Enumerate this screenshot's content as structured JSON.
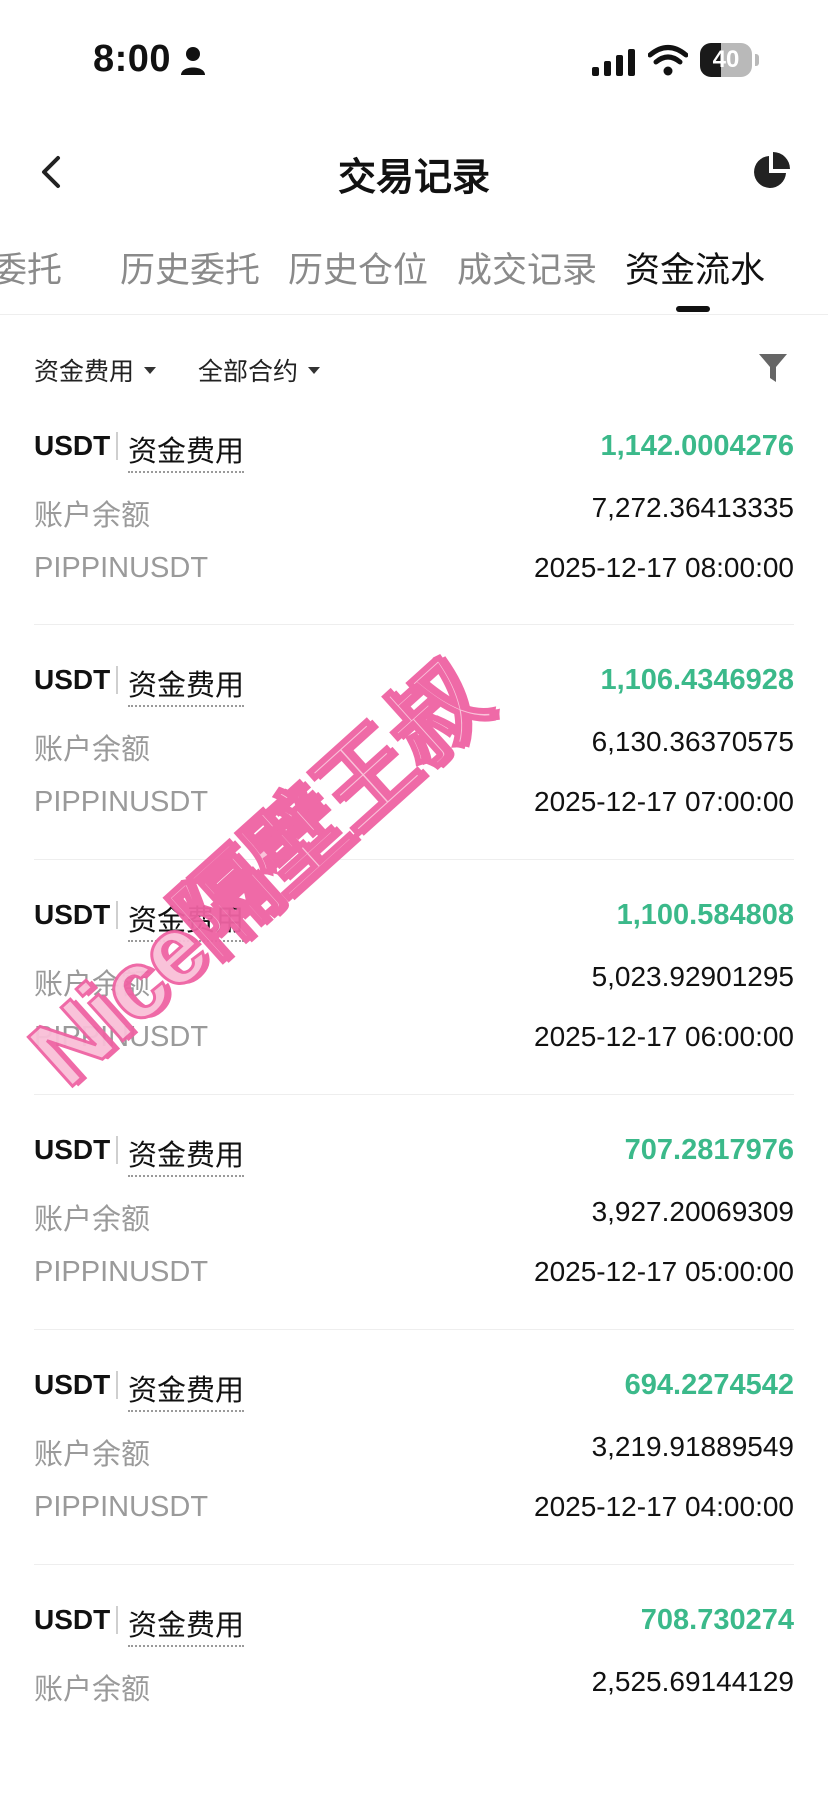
{
  "status_bar": {
    "time": "8:00",
    "battery": "40"
  },
  "header": {
    "title": "交易记录"
  },
  "tabs": [
    {
      "label": "委托"
    },
    {
      "label": "历史委托"
    },
    {
      "label": "历史仓位"
    },
    {
      "label": "成交记录"
    },
    {
      "label": "资金流水"
    }
  ],
  "filters": {
    "type": "资金费用",
    "contract": "全部合约"
  },
  "records": [
    {
      "currency": "USDT",
      "type": "资金费用",
      "amount": "1,142.0004276",
      "balance_label": "账户余额",
      "balance": "7,272.36413335",
      "symbol": "PIPPINUSDT",
      "time": "2025-12-17 08:00:00"
    },
    {
      "currency": "USDT",
      "type": "资金费用",
      "amount": "1,106.4346928",
      "balance_label": "账户余额",
      "balance": "6,130.36370575",
      "symbol": "PIPPINUSDT",
      "time": "2025-12-17 07:00:00"
    },
    {
      "currency": "USDT",
      "type": "资金费用",
      "amount": "1,100.584808",
      "balance_label": "账户余额",
      "balance": "5,023.92901295",
      "symbol": "PIPPINUSDT",
      "time": "2025-12-17 06:00:00"
    },
    {
      "currency": "USDT",
      "type": "资金费用",
      "amount": "707.2817976",
      "balance_label": "账户余额",
      "balance": "3,927.20069309",
      "symbol": "PIPPINUSDT",
      "time": "2025-12-17 05:00:00"
    },
    {
      "currency": "USDT",
      "type": "资金费用",
      "amount": "694.2274542",
      "balance_label": "账户余额",
      "balance": "3,219.91889549",
      "symbol": "PIPPINUSDT",
      "time": "2025-12-17 04:00:00"
    },
    {
      "currency": "USDT",
      "type": "资金费用",
      "amount": "708.730274",
      "balance_label": "账户余额",
      "balance": "2,525.69144129"
    }
  ],
  "watermark": "Nice隔壁王叔",
  "colors": {
    "positive": "#3bb98a",
    "muted": "#9a9a9a",
    "watermark_fill": "#f9bfd8",
    "watermark_stroke": "#ef63a3"
  }
}
